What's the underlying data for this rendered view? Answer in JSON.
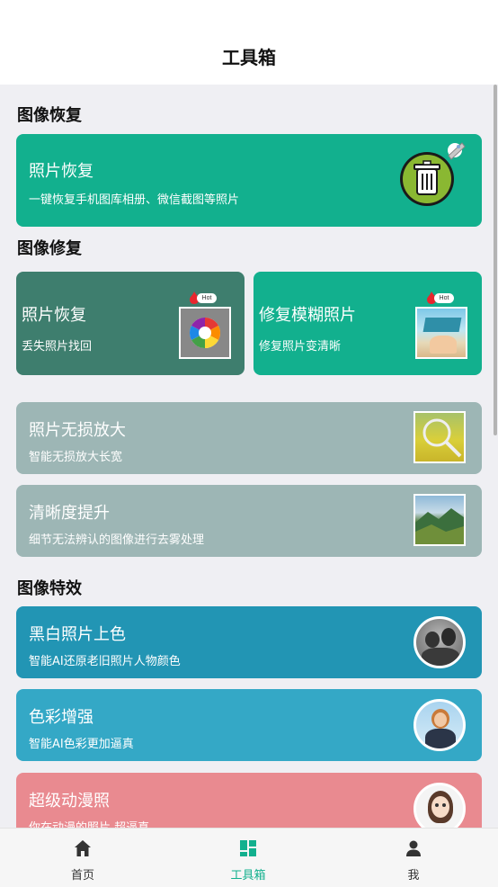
{
  "header": {
    "title": "工具箱"
  },
  "sections": {
    "recover": "图像恢复",
    "repair": "图像修复",
    "effects": "图像特效"
  },
  "cards": {
    "photo_recover": {
      "title": "照片恢复",
      "desc": "一键恢复手机图库相册、微信截图等照片"
    },
    "lost_recover": {
      "title": "照片恢复",
      "desc": "丢失照片找回",
      "badge": "Hot"
    },
    "blur_fix": {
      "title": "修复模糊照片",
      "desc": "修复照片变清晰",
      "badge": "Hot"
    },
    "lossless": {
      "title": "照片无损放大",
      "desc": "智能无损放大长宽"
    },
    "clarity": {
      "title": "清晰度提升",
      "desc": "细节无法辨认的图像进行去雾处理"
    },
    "colorize": {
      "title": "黑白照片上色",
      "desc": "智能AI还原老旧照片人物颜色"
    },
    "enhance": {
      "title": "色彩增强",
      "desc": "智能AI色彩更加逼真"
    },
    "anime": {
      "title": "超级动漫照",
      "desc": "你在动漫的照片 超逼真"
    }
  },
  "tabs": [
    {
      "label": "首页",
      "icon": "home-icon"
    },
    {
      "label": "工具箱",
      "icon": "toolbox-icon",
      "active": true
    },
    {
      "label": "我",
      "icon": "person-icon"
    }
  ],
  "colors": {
    "accent": "#12b08e",
    "dark_green": "#3e7e6e",
    "grey_teal": "#9db6b5",
    "blue": "#2295b4",
    "light_blue": "#34a8c6",
    "pink": "#e98a90"
  }
}
